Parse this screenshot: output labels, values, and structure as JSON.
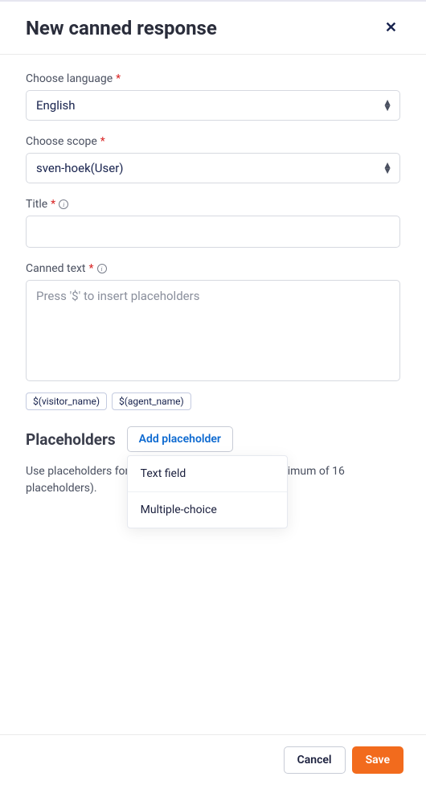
{
  "header": {
    "title": "New canned response"
  },
  "language": {
    "label": "Choose language",
    "value": "English"
  },
  "scope": {
    "label": "Choose scope",
    "value": "sven-hoek(User)"
  },
  "titleField": {
    "label": "Title",
    "value": ""
  },
  "canned": {
    "label": "Canned text",
    "placeholder": "Press '$' to insert placeholders"
  },
  "tags": {
    "visitor": "$(visitor_name)",
    "agent": "$(agent_name)"
  },
  "placeholders": {
    "heading": "Placeholders",
    "addButton": "Add placeholder",
    "desc": "Use placeholders for personalized responses (a maximum of 16 placeholders).",
    "menu": {
      "textField": "Text field",
      "multiChoice": "Multiple-choice"
    }
  },
  "footer": {
    "cancel": "Cancel",
    "save": "Save"
  }
}
